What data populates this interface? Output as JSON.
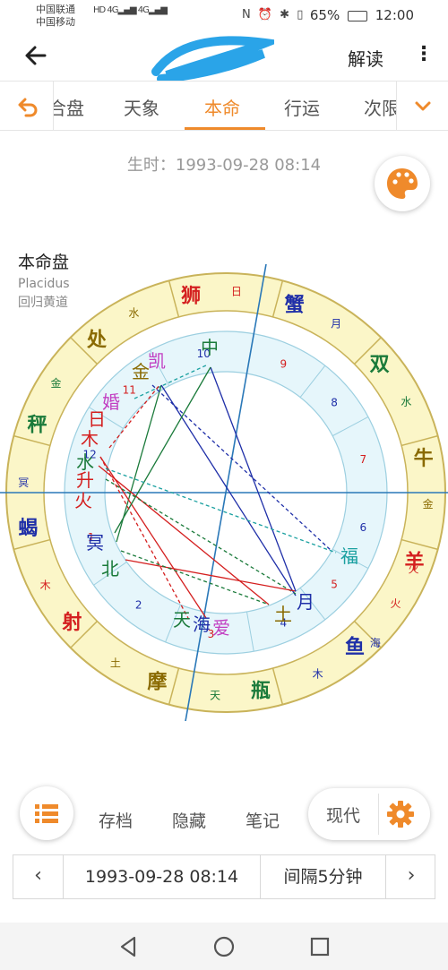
{
  "status_bar": {
    "carrier1": "中国联通",
    "carrier2": "中国移动",
    "hd": "HD",
    "net": "4G",
    "battery": "65%",
    "time": "12:00"
  },
  "app_bar": {
    "action_label": "解读"
  },
  "tabs": [
    {
      "label": "合盘"
    },
    {
      "label": "天象"
    },
    {
      "label": "本命"
    },
    {
      "label": "行运"
    },
    {
      "label": "次限"
    }
  ],
  "active_tab": "本命",
  "birth_time_label": "生时：1993-09-28 08:14",
  "chart_info": {
    "title": "本命盘",
    "house_system": "Placidus",
    "zodiac": "回归黄道"
  },
  "wheel": {
    "signs": [
      {
        "name": "狮",
        "ruler": "日",
        "color": "#d41f1f",
        "ruler_color": "#d41f1f"
      },
      {
        "name": "蟹",
        "ruler": "月",
        "color": "#1f2fa8",
        "ruler_color": "#1f2fa8"
      },
      {
        "name": "双",
        "ruler": "水",
        "color": "#1a7a3a",
        "ruler_color": "#1a7a3a"
      },
      {
        "name": "牛",
        "ruler": "金",
        "color": "#8a6a00",
        "ruler_color": "#8a6a00"
      },
      {
        "name": "羊",
        "ruler": "火",
        "color": "#d41f1f",
        "ruler_color": "#d41f1f"
      },
      {
        "name": "鱼",
        "ruler": "木",
        "color": "#1f2fa8",
        "ruler_color": "#1f2fa8"
      },
      {
        "name": "瓶",
        "ruler": "天",
        "color": "#1a7a3a",
        "ruler_color": "#1a7a3a"
      },
      {
        "name": "摩",
        "ruler": "土",
        "color": "#8a6a00",
        "ruler_color": "#8a6a00"
      },
      {
        "name": "射",
        "ruler": "木",
        "color": "#d41f1f",
        "ruler_color": "#d41f1f"
      },
      {
        "name": "蝎",
        "ruler": "冥",
        "color": "#1f2fa8",
        "ruler_color": "#1f2fa8"
      },
      {
        "name": "秤",
        "ruler": "金",
        "color": "#1a7a3a",
        "ruler_color": "#1a7a3a"
      },
      {
        "name": "处",
        "ruler": "水",
        "color": "#8a6a00",
        "ruler_color": "#8a6a00"
      }
    ],
    "extra_rulers": [
      "海",
      "火"
    ],
    "houses": [
      "9",
      "8",
      "7",
      "6",
      "5",
      "4",
      "3",
      "2",
      "1",
      "12",
      "11",
      "10"
    ],
    "planets": [
      {
        "glyph": "中",
        "color": "#1a7a3a"
      },
      {
        "glyph": "凯",
        "color": "#c23fc2"
      },
      {
        "glyph": "金",
        "color": "#8a6a00"
      },
      {
        "glyph": "婚",
        "color": "#c23fc2"
      },
      {
        "glyph": "日",
        "color": "#d41f1f"
      },
      {
        "glyph": "木",
        "color": "#d41f1f"
      },
      {
        "glyph": "水",
        "color": "#1a7a3a"
      },
      {
        "glyph": "升",
        "color": "#d41f1f"
      },
      {
        "glyph": "火",
        "color": "#d41f1f"
      },
      {
        "glyph": "冥",
        "color": "#1f2fa8"
      },
      {
        "glyph": "北",
        "color": "#1a7a3a"
      },
      {
        "glyph": "天",
        "color": "#1a7a3a"
      },
      {
        "glyph": "海",
        "color": "#1f2fa8"
      },
      {
        "glyph": "爱",
        "color": "#c23fc2"
      },
      {
        "glyph": "土",
        "color": "#8a6a00"
      },
      {
        "glyph": "月",
        "color": "#1f2fa8"
      },
      {
        "glyph": "福",
        "color": "#1aa0a0"
      }
    ]
  },
  "bottom": {
    "archive": "存档",
    "hide": "隐藏",
    "notes": "笔记",
    "mode": "现代"
  },
  "time_bar": {
    "date": "1993-09-28 08:14",
    "step": "间隔5分钟",
    "prev": "‹",
    "next": "›"
  }
}
